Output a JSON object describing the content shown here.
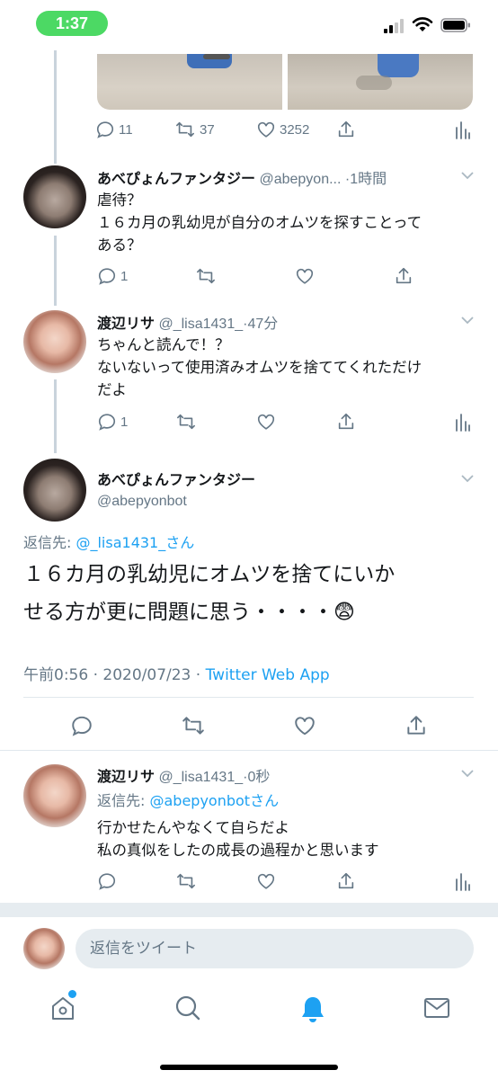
{
  "status_bar": {
    "time": "1:37"
  },
  "colors": {
    "accent": "#1da1f2",
    "muted": "#657786",
    "time_pill": "#4cd964"
  },
  "top_tweet": {
    "actions": {
      "replies": "11",
      "retweets": "37",
      "likes": "3252"
    }
  },
  "tweet1": {
    "name": "あべぴょんファンタジー",
    "handle": "@abepyon...",
    "time": "·1時間",
    "lines": [
      "虐待？",
      "１６カ月の乳幼児が自分のオムツを探すことって",
      "ある？"
    ],
    "actions": {
      "replies": "1"
    }
  },
  "tweet2": {
    "name": "渡辺リサ",
    "handle": "@_lisa1431_",
    "time": "·47分",
    "lines": [
      "ちゃんと読んで！？",
      "ないないって使用済みオムツを捨ててくれただけ",
      "だよ"
    ],
    "actions": {
      "replies": "1"
    }
  },
  "focus_tweet": {
    "name": "あべぴょんファンタジー",
    "handle": "@abepyonbot",
    "reply_prefix": "返信先: ",
    "reply_to": "@_lisa1431_さん",
    "lines": [
      "１６カ月の乳幼児にオムツを捨てにいか",
      "せる方が更に問題に思う・・・・😨"
    ],
    "timestamp": "午前0:56 · 2020/07/23 · ",
    "source": "Twitter Web App"
  },
  "tweet3": {
    "name": "渡辺リサ",
    "handle": "@_lisa1431_",
    "time": "·0秒",
    "reply_prefix": "返信先: ",
    "reply_to": "@abepyonbotさん",
    "lines": [
      "行かせたんやなくて自らだよ",
      "私の真似をしたの成長の過程かと思います"
    ]
  },
  "reply_bar": {
    "placeholder": "返信をツイート"
  },
  "tabbar": {
    "items": [
      "home-icon",
      "search-icon",
      "notifications-icon",
      "messages-icon"
    ]
  }
}
